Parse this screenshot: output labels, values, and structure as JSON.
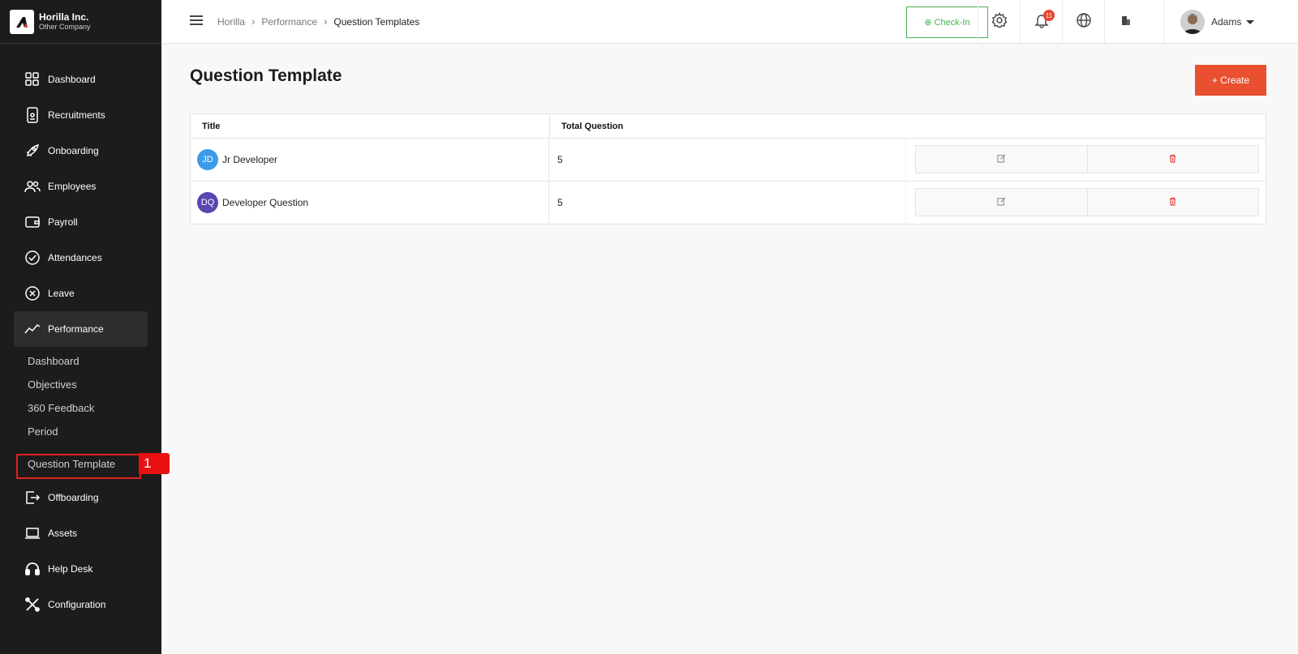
{
  "brand": {
    "name": "Horilla Inc.",
    "company": "Other Company"
  },
  "sidebar": {
    "items": [
      {
        "label": "Dashboard",
        "icon": "dashboard-icon"
      },
      {
        "label": "Recruitments",
        "icon": "recruitment-icon"
      },
      {
        "label": "Onboarding",
        "icon": "rocket-icon"
      },
      {
        "label": "Employees",
        "icon": "users-icon"
      },
      {
        "label": "Payroll",
        "icon": "wallet-icon"
      },
      {
        "label": "Attendances",
        "icon": "check-circle-icon"
      },
      {
        "label": "Leave",
        "icon": "x-circle-icon"
      },
      {
        "label": "Performance",
        "icon": "trend-icon"
      },
      {
        "label": "Offboarding",
        "icon": "exit-icon"
      },
      {
        "label": "Assets",
        "icon": "laptop-icon"
      },
      {
        "label": "Help Desk",
        "icon": "headset-icon"
      },
      {
        "label": "Configuration",
        "icon": "tools-icon"
      }
    ],
    "performance_sub": [
      "Dashboard",
      "Objectives",
      "360 Feedback",
      "Period",
      "Question Template"
    ]
  },
  "annotation": {
    "label": "1"
  },
  "topbar": {
    "breadcrumb": [
      "Horilla",
      "Performance",
      "Question Templates"
    ],
    "checkin_label": "Check-In",
    "notification_count": "11",
    "user_name": "Adams"
  },
  "main": {
    "title": "Question Template",
    "create_label": "+ Create",
    "columns": [
      "Title",
      "Total Question"
    ],
    "rows": [
      {
        "initials": "JD",
        "title": "Jr Developer",
        "count": "5",
        "color": "#3b9be8"
      },
      {
        "initials": "DQ",
        "title": "Developer Question",
        "count": "5",
        "color": "#5b45b0"
      }
    ]
  },
  "colors": {
    "accent": "#e8502f",
    "checkin": "#4caf50",
    "sidebar_bg": "#1c1c1c"
  }
}
